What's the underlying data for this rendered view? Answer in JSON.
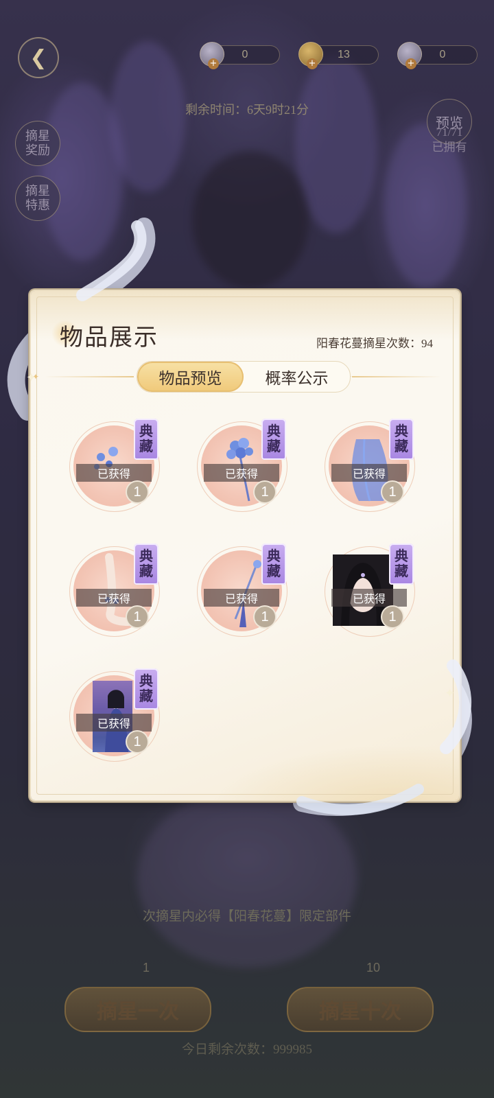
{
  "header": {
    "resources": [
      {
        "icon": "moon-orb-icon",
        "value": "0"
      },
      {
        "icon": "gold-coin-icon",
        "value": "13"
      },
      {
        "icon": "silver-orb-icon",
        "value": "0"
      }
    ],
    "timer": "剩余时间：6天9时21分"
  },
  "side": {
    "reward_label": "摘星奖励",
    "special_label": "摘星特惠",
    "preview_label": "预览",
    "owned_line1": "71/71",
    "owned_line2": "已拥有"
  },
  "panel": {
    "title": "物品展示",
    "count_label": "阳春花蔓摘星次数：94",
    "tabs": [
      {
        "label": "物品预览",
        "active": true
      },
      {
        "label": "概率公示",
        "active": false
      }
    ],
    "badge_label": "典藏",
    "obtained_label": "已获得",
    "items": [
      {
        "name": "blue-flower-hairpin",
        "qty": "1"
      },
      {
        "name": "hydrangea-scepter",
        "qty": "1"
      },
      {
        "name": "blue-veil",
        "qty": "1"
      },
      {
        "name": "anklet",
        "qty": "1"
      },
      {
        "name": "tassel-hairpin",
        "qty": "1"
      },
      {
        "name": "hairstyle-portrait",
        "qty": "1"
      },
      {
        "name": "outfit-card",
        "qty": "1"
      }
    ]
  },
  "footer": {
    "guarantee": "次摘星内必得【阳春花蔓】限定部件",
    "single_cost": "1",
    "ten_cost": "10",
    "single_button": "摘星一次",
    "ten_button": "摘星十次",
    "today": "今日剩余次数：999985"
  }
}
